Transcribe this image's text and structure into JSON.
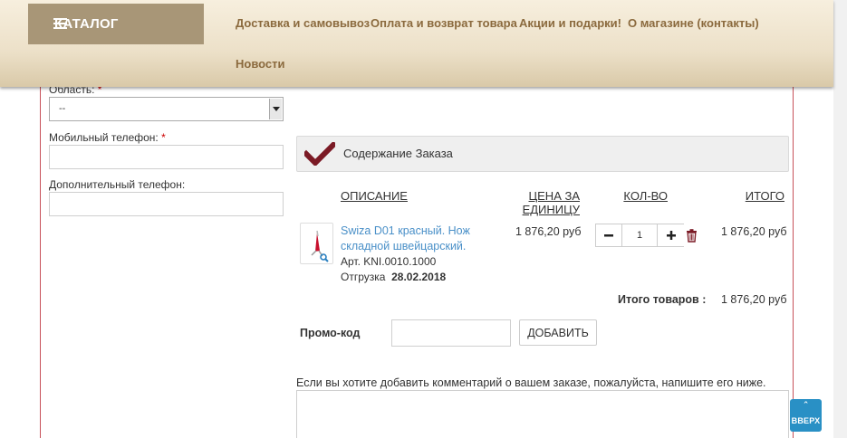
{
  "header": {
    "catalog_label": "КАТАЛОГ",
    "nav": [
      "Доставка и самовывоз",
      "Оплата и возврат товара",
      "Акции и подарки!",
      "О магазине (контакты)",
      "Новости"
    ]
  },
  "form": {
    "region_label": "Область:",
    "region_value": "--",
    "mobile_label": "Мобильный телефон:",
    "extra_phone_label": "Дополнительный телефон:",
    "required_mark": "*"
  },
  "order": {
    "title": "Содержание Заказа",
    "columns": {
      "description": "ОПИСАНИЕ",
      "unit_price_line1": "ЦЕНА ЗА",
      "unit_price_line2": "ЕДИНИЦУ",
      "qty": "КОЛ-ВО",
      "total": "ИТОГО"
    },
    "item": {
      "name": "Swiza D01 красный. Нож складной швейцарский.",
      "sku": "Арт. KNI.0010.1000",
      "shipment_label": "Отгрузка",
      "shipment_date": "28.02.2018",
      "unit_price": "1 876,20 руб",
      "qty": "1",
      "total": "1 876,20 руб"
    },
    "summary_label": "Итого товаров :",
    "summary_value": "1 876,20 руб",
    "promo_label": "Промо-код",
    "promo_value": "",
    "add_button": "ДОБАВИТЬ",
    "comment_hint": "Если вы хотите добавить комментарий о вашем заказе, пожалуйста, напишите его ниже."
  },
  "up_button": "ВВЕРХ",
  "colors": {
    "catalog_bg": "#a89677",
    "nav_text": "#8b6a3e",
    "link": "#4a90c8",
    "accent_check": "#7b1a25",
    "up_button": "#2990c5"
  }
}
